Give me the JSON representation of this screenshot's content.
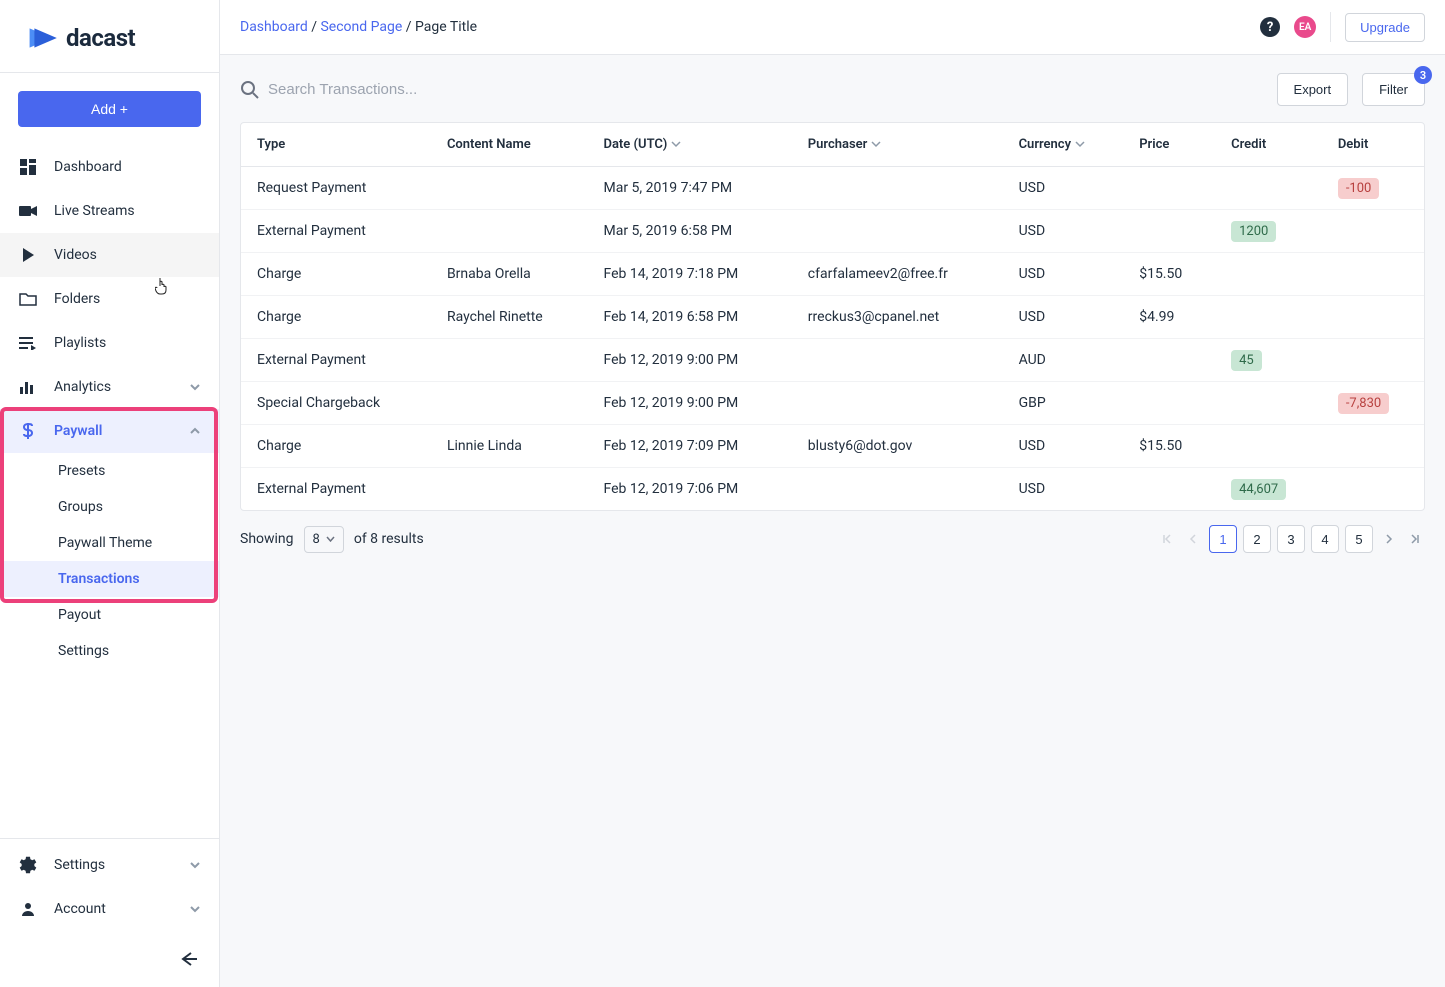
{
  "logo_text": "dacast",
  "add_button": "Add +",
  "nav": [
    {
      "id": "dashboard",
      "label": "Dashboard"
    },
    {
      "id": "livestreams",
      "label": "Live Streams"
    },
    {
      "id": "videos",
      "label": "Videos"
    },
    {
      "id": "folders",
      "label": "Folders"
    },
    {
      "id": "playlists",
      "label": "Playlists"
    },
    {
      "id": "analytics",
      "label": "Analytics",
      "expandable": true
    },
    {
      "id": "paywall",
      "label": "Paywall",
      "expandable": true,
      "active": true
    }
  ],
  "paywall_sub": [
    {
      "id": "presets",
      "label": "Presets"
    },
    {
      "id": "groups",
      "label": "Groups"
    },
    {
      "id": "theme",
      "label": "Paywall Theme"
    },
    {
      "id": "transactions",
      "label": "Transactions",
      "active": true
    },
    {
      "id": "payout",
      "label": "Payout"
    },
    {
      "id": "settings",
      "label": "Settings"
    }
  ],
  "nav_footer": [
    {
      "id": "settings",
      "label": "Settings"
    },
    {
      "id": "account",
      "label": "Account"
    }
  ],
  "breadcrumb": {
    "p1": "Dashboard",
    "p2": "Second Page",
    "p3": "Page Title"
  },
  "avatar_initials": "EA",
  "upgrade": "Upgrade",
  "search_placeholder": "Search Transactions...",
  "export": "Export",
  "filter": "Filter",
  "filter_badge": "3",
  "columns": {
    "type": "Type",
    "content": "Content Name",
    "date": "Date (UTC)",
    "purchaser": "Purchaser",
    "currency": "Currency",
    "price": "Price",
    "credit": "Credit",
    "debit": "Debit"
  },
  "rows": [
    {
      "type": "Request Payment",
      "content": "",
      "date": "Mar 5, 2019 7:47 PM",
      "purchaser": "",
      "currency": "USD",
      "price": "",
      "credit": "",
      "debit": "-100"
    },
    {
      "type": "External Payment",
      "content": "",
      "date": "Mar 5, 2019 6:58 PM",
      "purchaser": "",
      "currency": "USD",
      "price": "",
      "credit": "1200",
      "debit": ""
    },
    {
      "type": "Charge",
      "content": "Brnaba Orella",
      "date": "Feb 14, 2019 7:18 PM",
      "purchaser": "cfarfalameev2@free.fr",
      "currency": "USD",
      "price": "$15.50",
      "credit": "",
      "debit": ""
    },
    {
      "type": "Charge",
      "content": "Raychel Rinette",
      "date": "Feb 14, 2019 6:58 PM",
      "purchaser": "rreckus3@cpanel.net",
      "currency": "USD",
      "price": "$4.99",
      "credit": "",
      "debit": ""
    },
    {
      "type": "External Payment",
      "content": "",
      "date": "Feb 12, 2019 9:00 PM",
      "purchaser": "",
      "currency": "AUD",
      "price": "",
      "credit": "45",
      "debit": ""
    },
    {
      "type": "Special Chargeback",
      "content": "",
      "date": "Feb 12, 2019 9:00 PM",
      "purchaser": "",
      "currency": "GBP",
      "price": "",
      "credit": "",
      "debit": "-7,830"
    },
    {
      "type": "Charge",
      "content": "Linnie Linda",
      "date": "Feb 12, 2019 7:09 PM",
      "purchaser": "blusty6@dot.gov",
      "currency": "USD",
      "price": "$15.50",
      "credit": "",
      "debit": ""
    },
    {
      "type": "External Payment",
      "content": "",
      "date": "Feb 12, 2019 7:06 PM",
      "purchaser": "",
      "currency": "USD",
      "price": "",
      "credit": "44,607",
      "debit": ""
    }
  ],
  "pagination": {
    "showing": "Showing",
    "per_page": "8",
    "of_results": "of 8 results",
    "pages": [
      "1",
      "2",
      "3",
      "4",
      "5"
    ],
    "current": "1"
  }
}
